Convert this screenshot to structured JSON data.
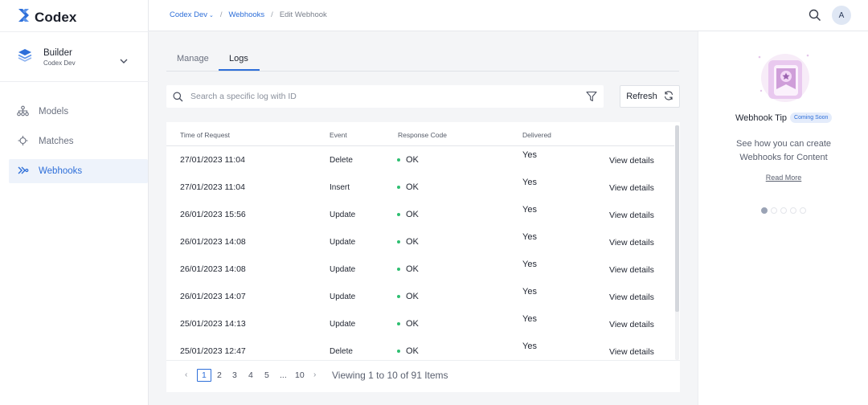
{
  "app": {
    "name": "Codex"
  },
  "project": {
    "name": "Builder",
    "workspace": "Codex Dev"
  },
  "sidebar": {
    "items": [
      {
        "label": "Models",
        "icon": "models-icon"
      },
      {
        "label": "Matches",
        "icon": "matches-icon"
      },
      {
        "label": "Webhooks",
        "icon": "webhooks-icon",
        "active": true
      }
    ]
  },
  "breadcrumb": {
    "workspace": "Codex Dev",
    "section": "Webhooks",
    "current": "Edit Webhook"
  },
  "user": {
    "initial": "A"
  },
  "tabs": [
    {
      "label": "Manage"
    },
    {
      "label": "Logs",
      "active": true
    }
  ],
  "search": {
    "placeholder": "Search a specific log with ID"
  },
  "toolbar": {
    "refresh_label": "Refresh"
  },
  "table": {
    "headers": [
      "Time of Request",
      "Event",
      "Response Code",
      "Delivered"
    ],
    "view_label": "View details",
    "rows": [
      {
        "time": "27/01/2023 11:04",
        "event": "Delete",
        "code": "OK",
        "delivered": "Yes"
      },
      {
        "time": "27/01/2023 11:04",
        "event": "Insert",
        "code": "OK",
        "delivered": "Yes"
      },
      {
        "time": "26/01/2023 15:56",
        "event": "Update",
        "code": "OK",
        "delivered": "Yes"
      },
      {
        "time": "26/01/2023 14:08",
        "event": "Update",
        "code": "OK",
        "delivered": "Yes"
      },
      {
        "time": "26/01/2023 14:08",
        "event": "Update",
        "code": "OK",
        "delivered": "Yes"
      },
      {
        "time": "26/01/2023 14:07",
        "event": "Update",
        "code": "OK",
        "delivered": "Yes"
      },
      {
        "time": "25/01/2023 14:13",
        "event": "Update",
        "code": "OK",
        "delivered": "Yes"
      },
      {
        "time": "25/01/2023 12:47",
        "event": "Delete",
        "code": "OK",
        "delivered": "Yes"
      }
    ]
  },
  "pagination": {
    "pages": [
      "1",
      "2",
      "3",
      "4",
      "5",
      "...",
      "10"
    ],
    "current": "1",
    "info": "Viewing 1 to 10 of 91 Items"
  },
  "tip": {
    "title": "Webhook Tip",
    "badge": "Coming Soon",
    "line1": "See how you can create",
    "line2": "Webhooks for Content",
    "link": "Read More",
    "slides": 5,
    "active_slide": 1
  },
  "colors": {
    "accent": "#2e6fd9",
    "success": "#2fbf71",
    "brand": "#2e6fd9"
  }
}
